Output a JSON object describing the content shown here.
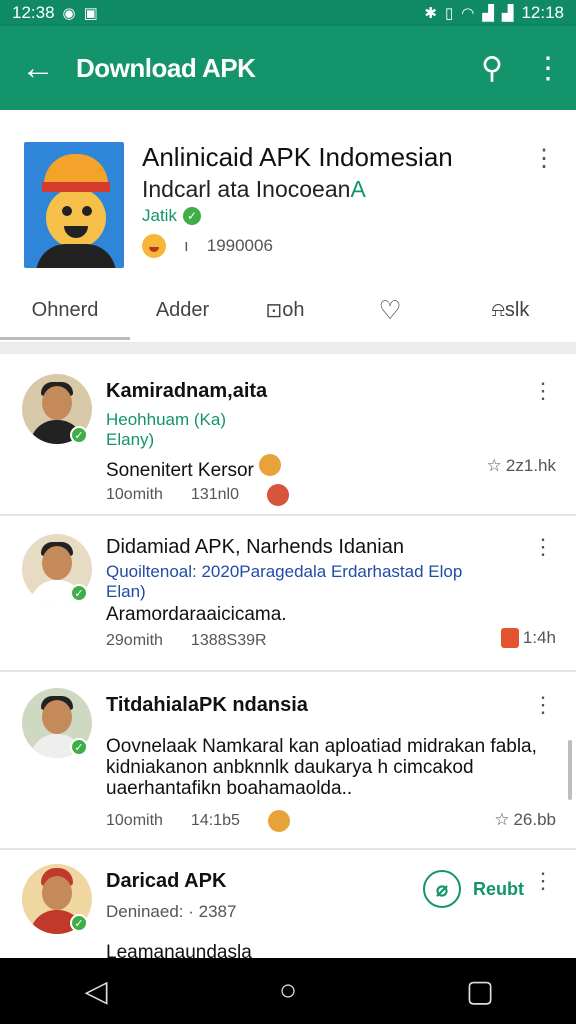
{
  "status_bar": {
    "time_left": "12:38",
    "time_right": "12:18"
  },
  "toolbar": {
    "title": "Download APK"
  },
  "app": {
    "title": "Anlinicaid APK Indomesian",
    "subtitle_main": "Indcarl ata Inocoean",
    "subtitle_accent": "A",
    "developer": "Jatik",
    "rating_count": "1990006"
  },
  "tabs": [
    {
      "label": "Ohnerd"
    },
    {
      "label": "Adder"
    },
    {
      "label": "oh"
    },
    {
      "label": ""
    },
    {
      "label": "slk"
    }
  ],
  "reviews": [
    {
      "name": "Kamiradnam,aita",
      "line1": "Heohhuam (Ka)",
      "line2": "Elany)",
      "text": "Sonenitert Kersor",
      "time": "10omith",
      "count": "131nl0",
      "right": "2z1.hk"
    },
    {
      "name": "Didamiad APK, Narhends Idanian",
      "line1": "Quoiltenoal: 2020Paragedala Erdarhastad Elop",
      "line2": "Elan)",
      "text": "Aramordaraaicicama.",
      "time": "29omith",
      "count": "1388S39R",
      "right": "1:4h"
    },
    {
      "name": "TitdahialaPK ndansia",
      "text": "Oovnelaak Namkaral kan aploatiad midrakan fabla, kidniakanon anbknnlk daukarya h cimcakod uaerhantafikn boahamaolda..",
      "time": "10omith",
      "count": "14:1b5",
      "right": "26.bb"
    },
    {
      "name": "Daricad APK",
      "line1": "Deninaed: · 2387",
      "reply_label": "Reubt",
      "text": "Leamanaundasla"
    }
  ]
}
